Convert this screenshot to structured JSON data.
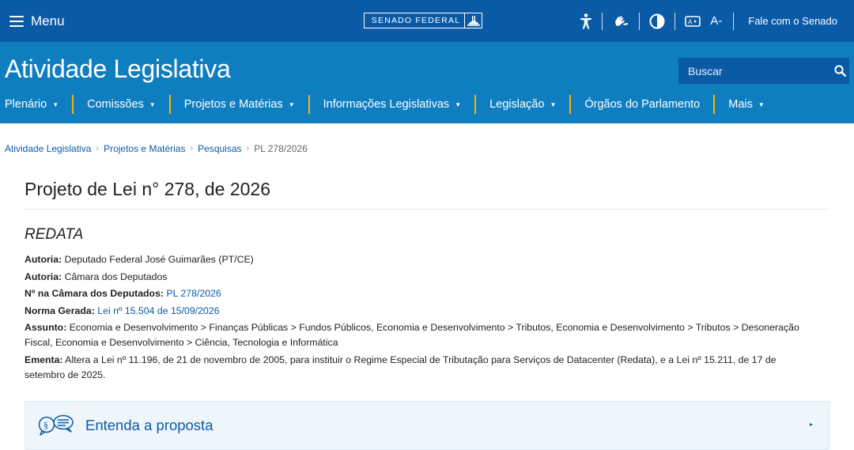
{
  "topbar": {
    "menu_label": "Menu",
    "logo_text": "SENADO FEDERAL",
    "contact_label": "Fale com o Senado",
    "tools": [
      "accessibility-icon",
      "sign-language-icon",
      "contrast-icon",
      "libras-icon",
      "font-size-icon"
    ],
    "font_size_label": "A-"
  },
  "header": {
    "site_title": "Atividade Legislativa",
    "search_placeholder": "Buscar",
    "nav": [
      {
        "label": "Plenário",
        "caret": "▼"
      },
      {
        "label": "Comissões",
        "caret": "▼"
      },
      {
        "label": "Projetos e Matérias",
        "caret": "▼"
      },
      {
        "label": "Informações Legislativas",
        "caret": "▼"
      },
      {
        "label": "Legislação",
        "caret": "▼"
      },
      {
        "label": "Órgãos do Parlamento",
        "caret": ""
      },
      {
        "label": "Mais",
        "caret": "▼"
      }
    ]
  },
  "breadcrumb": {
    "items": [
      "Atividade Legislativa",
      "Projetos e Matérias",
      "Pesquisas"
    ],
    "current": "PL 278/2026",
    "separator": "›"
  },
  "main": {
    "title": "Projeto de Lei n° 278, de 2026",
    "sigla": "REDATA",
    "autoria1_label": "Autoria:",
    "autoria1_value": "Deputado Federal José Guimarães (PT/CE)",
    "autoria2_label": "Autoria:",
    "autoria2_value": "Câmara dos Deputados",
    "camara_label": "Nº na Câmara dos Deputados:",
    "camara_value": "PL 278/2026",
    "norma_label": "Norma Gerada:",
    "norma_value": "Lei nº 15.504 de 15/09/2026",
    "assunto_label": "Assunto:",
    "assunto_value": "Economia e Desenvolvimento > Finanças Públicas > Fundos Públicos, Economia e Desenvolvimento > Tributos, Economia e Desenvolvimento > Tributos > Desoneração Fiscal, Economia e Desenvolvimento > Ciência, Tecnologia e Informática",
    "ementa_label": "Ementa:",
    "ementa_value": "Altera a Lei nº 11.196, de 21 de novembro de 2005, para instituir o Regime Especial de Tributação para Serviços de Datacenter (Redata), e a Lei nº 15.211, de 17 de setembro de 2025."
  },
  "entenda": {
    "label": "Entenda a proposta",
    "arrow": "▸"
  },
  "colors": {
    "topbar": "#0a5aa6",
    "header": "#0f7ec1",
    "nav_separator": "#f2b705",
    "link": "#0a5aa6"
  }
}
